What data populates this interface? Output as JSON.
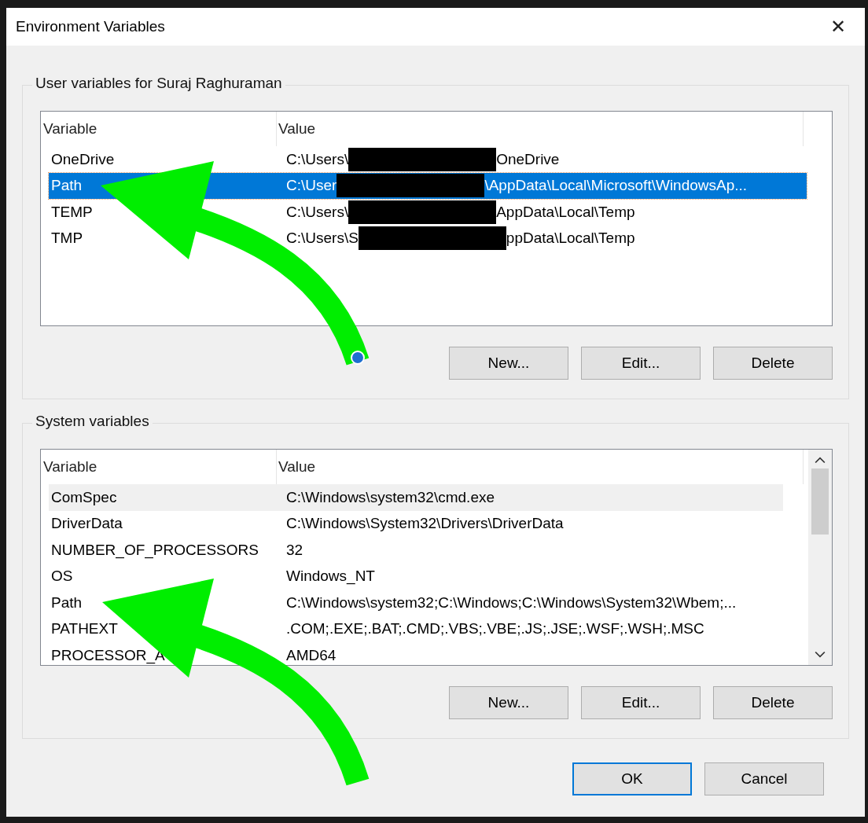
{
  "window": {
    "title": "Environment Variables",
    "close": "✕"
  },
  "user_group": {
    "title": "User variables for Suraj Raghuraman",
    "focused": true,
    "columns": [
      "Variable",
      "Value"
    ],
    "rows": [
      {
        "name": "OneDrive",
        "value_start": "C:\\Users\\",
        "value_end": "OneDrive",
        "selected": false
      },
      {
        "name": "Path",
        "value_start": "C:\\User",
        "value_end": "\\AppData\\Local\\Microsoft\\WindowsAp...",
        "selected": true
      },
      {
        "name": "TEMP",
        "value_start": "C:\\Users\\",
        "value_end": "AppData\\Local\\Temp",
        "selected": false
      },
      {
        "name": "TMP",
        "value_start": "C:\\Users\\S",
        "value_end": "ppData\\Local\\Temp",
        "selected": false
      }
    ],
    "buttons": [
      "New...",
      "Edit...",
      "Delete"
    ]
  },
  "system_group": {
    "title": "System variables",
    "focused": false,
    "columns": [
      "Variable",
      "Value"
    ],
    "rows": [
      {
        "name": "ComSpec",
        "value": "C:\\Windows\\system32\\cmd.exe",
        "selected": true
      },
      {
        "name": "DriverData",
        "value": "C:\\Windows\\System32\\Drivers\\DriverData",
        "selected": false
      },
      {
        "name": "NUMBER_OF_PROCESSORS",
        "value": "32",
        "selected": false
      },
      {
        "name": "OS",
        "value": "Windows_NT",
        "selected": false
      },
      {
        "name": "Path",
        "value": "C:\\Windows\\system32;C:\\Windows;C:\\Windows\\System32\\Wbem;...",
        "selected": false
      },
      {
        "name": "PATHEXT",
        "value": ".COM;.EXE;.BAT;.CMD;.VBS;.VBE;.JS;.JSE;.WSF;.WSH;.MSC",
        "selected": false
      },
      {
        "name": "PROCESSOR_A",
        "value": "AMD64",
        "selected": false
      }
    ],
    "buttons": [
      "New...",
      "Edit...",
      "Delete"
    ]
  },
  "footer_buttons": [
    {
      "label": "OK",
      "kind": "default"
    },
    {
      "label": "Cancel",
      "kind": "normal"
    }
  ]
}
